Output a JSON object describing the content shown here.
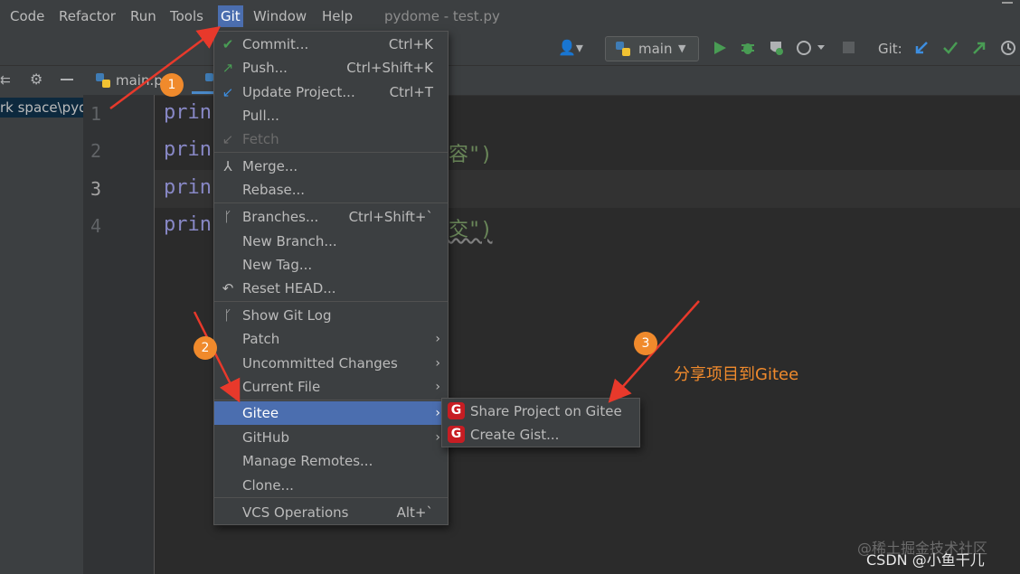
{
  "menubar": {
    "items": [
      {
        "label": "Code"
      },
      {
        "label": "Refactor"
      },
      {
        "label": "Run"
      },
      {
        "label": "Tools"
      },
      {
        "label": "Git",
        "active": true
      },
      {
        "label": "Window"
      },
      {
        "label": "Help"
      }
    ],
    "window_title": "pydome - test.py"
  },
  "toolbar": {
    "branch": "main",
    "git_label": "Git:"
  },
  "project_panel": {
    "path_text": "rk space\\pyd"
  },
  "tabs": {
    "first_tab": "main.py"
  },
  "editor": {
    "line_numbers": [
      "1",
      "2",
      "3",
      "4"
    ],
    "current_line": "3",
    "lines": [
      {
        "code": "prin",
        "tail": ""
      },
      {
        "code": "prin",
        "tail": "容\")"
      },
      {
        "code": "prin",
        "tail": ""
      },
      {
        "code": "prin",
        "tail": "交\")"
      }
    ]
  },
  "git_menu": {
    "items": [
      {
        "label": "Commit...",
        "shortcut": "Ctrl+K",
        "icon": "check-icon"
      },
      {
        "label": "Push...",
        "shortcut": "Ctrl+Shift+K",
        "icon": "push-arrow-icon"
      },
      {
        "label": "Update Project...",
        "shortcut": "Ctrl+T",
        "icon": "update-arrow-icon"
      },
      {
        "label": "Pull...",
        "shortcut": ""
      },
      {
        "label": "Fetch",
        "shortcut": "",
        "disabled": true,
        "icon": "fetch-icon"
      },
      {
        "label": "Merge...",
        "shortcut": "",
        "icon": "merge-icon"
      },
      {
        "label": "Rebase...",
        "shortcut": ""
      },
      {
        "label": "Branches...",
        "shortcut": "Ctrl+Shift+`",
        "icon": "branch-icon"
      },
      {
        "label": "New Branch...",
        "shortcut": ""
      },
      {
        "label": "New Tag...",
        "shortcut": ""
      },
      {
        "label": "Reset HEAD...",
        "shortcut": "",
        "icon": "reset-icon"
      },
      {
        "label": "Show Git Log",
        "shortcut": "",
        "icon": "git-log-icon"
      },
      {
        "label": "Patch",
        "submenu": true
      },
      {
        "label": "Uncommitted Changes",
        "submenu": true
      },
      {
        "label": "Current File",
        "submenu": true
      },
      {
        "label": "Gitee",
        "submenu": true,
        "highlighted": true
      },
      {
        "label": "GitHub",
        "submenu": true
      },
      {
        "label": "Manage Remotes...",
        "shortcut": ""
      },
      {
        "label": "Clone...",
        "shortcut": ""
      },
      {
        "label": "VCS Operations",
        "shortcut": "Alt+`"
      }
    ]
  },
  "gitee_submenu": {
    "items": [
      {
        "label": "Share Project on Gitee",
        "icon": "gitee-icon"
      },
      {
        "label": "Create Gist...",
        "icon": "gitee-icon"
      }
    ]
  },
  "annotations": {
    "badges": [
      "1",
      "2",
      "3"
    ],
    "note": "分享项目到Gitee",
    "accent_color": "#f08a2c"
  },
  "watermark": {
    "line1": "@稀土掘金技术社区",
    "line2": "CSDN @小鱼干儿"
  },
  "colors": {
    "menu_bg": "#3c3f41",
    "highlight": "#4b6eaf",
    "editor_bg": "#2b2b2b"
  }
}
